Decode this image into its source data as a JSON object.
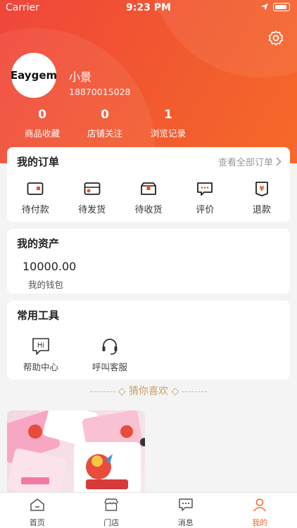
{
  "status_bar": {
    "carrier": "Carrier",
    "time": "9:23 PM"
  },
  "profile": {
    "avatar_text": "Eaygem",
    "name": "小景",
    "phone": "18870015028",
    "stats": [
      {
        "value": "0",
        "label": "商品收藏"
      },
      {
        "value": "0",
        "label": "店铺关注"
      },
      {
        "value": "1",
        "label": "浏览记录"
      }
    ]
  },
  "orders": {
    "title": "我的订单",
    "view_all": "查看全部订单",
    "items": [
      {
        "label": "待付款",
        "icon": "wallet-icon"
      },
      {
        "label": "待发货",
        "icon": "package-send-icon"
      },
      {
        "label": "待收货",
        "icon": "package-receive-icon"
      },
      {
        "label": "评价",
        "icon": "comment-icon"
      },
      {
        "label": "退款",
        "icon": "refund-icon"
      }
    ]
  },
  "assets": {
    "title": "我的资产",
    "wallet_value": "10000.00",
    "wallet_label": "我的钱包"
  },
  "tools": {
    "title": "常用工具",
    "items": [
      {
        "label": "帮助中心",
        "icon": "help-hi-icon"
      },
      {
        "label": "呼叫客服",
        "icon": "headset-icon"
      }
    ]
  },
  "recommend": {
    "title": "猜你喜欢"
  },
  "tabbar": {
    "items": [
      {
        "label": "首页",
        "icon": "home-icon"
      },
      {
        "label": "门店",
        "icon": "store-icon"
      },
      {
        "label": "消息",
        "icon": "message-icon"
      },
      {
        "label": "我的",
        "icon": "user-icon",
        "active": true
      }
    ]
  },
  "colors": {
    "accent": "#f06a2a",
    "hero_start": "#f0453b",
    "hero_end": "#f7692a",
    "gold": "#c8a06b"
  }
}
